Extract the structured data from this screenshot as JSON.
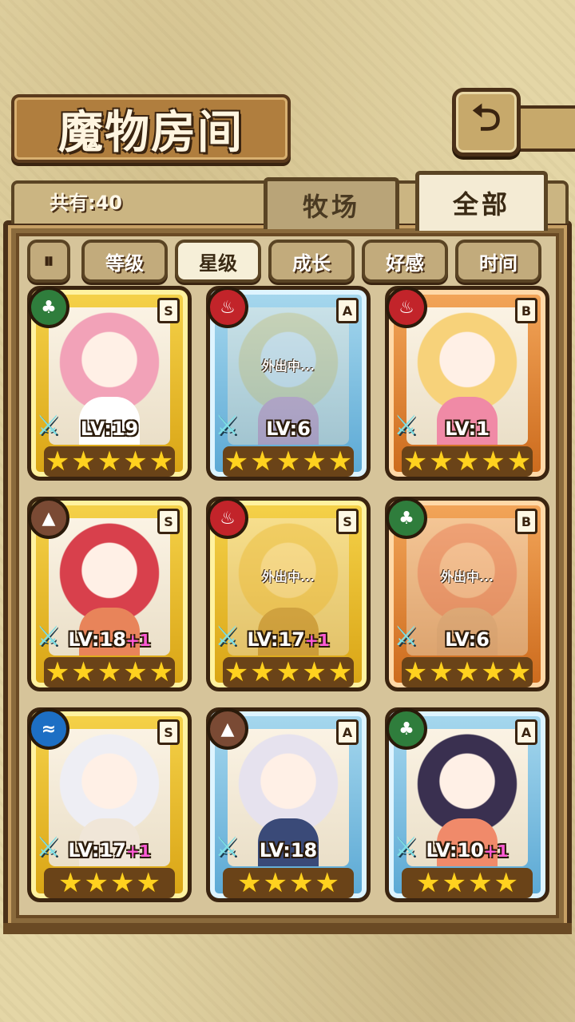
{
  "title": "魔物房间",
  "back_icon": "back-arrow-icon",
  "count_text": "共有:40",
  "top_tabs": [
    {
      "label": "牧场",
      "active": false
    },
    {
      "label": "全部",
      "active": true
    }
  ],
  "sort_buttons": [
    {
      "label": "等级",
      "active": false
    },
    {
      "label": "星级",
      "active": true
    },
    {
      "label": "成长",
      "active": false
    },
    {
      "label": "好感",
      "active": false
    },
    {
      "label": "时间",
      "active": false
    }
  ],
  "away_label": "外出中...",
  "monsters": [
    {
      "element": "grass",
      "grade": "S",
      "frame": "gold",
      "level": "LV:19",
      "plus": "",
      "stars": 5,
      "away": false,
      "hair": "#f2a2b8",
      "outfit": "#ffffff"
    },
    {
      "element": "fire",
      "grade": "A",
      "frame": "blue",
      "level": "LV:6",
      "plus": "",
      "stars": 5,
      "away": true,
      "hair": "#f7d27a",
      "outfit": "#f08aa6"
    },
    {
      "element": "fire",
      "grade": "B",
      "frame": "bronze",
      "level": "LV:1",
      "plus": "",
      "stars": 5,
      "away": false,
      "hair": "#f7d27a",
      "outfit": "#f08aa6"
    },
    {
      "element": "rock",
      "grade": "S",
      "frame": "gold",
      "level": "LV:18",
      "plus": "+1",
      "stars": 5,
      "away": false,
      "hair": "#d8404c",
      "outfit": "#e8845a"
    },
    {
      "element": "fire",
      "grade": "S",
      "frame": "gold",
      "level": "LV:17",
      "plus": "+1",
      "stars": 5,
      "away": true,
      "hair": "#f1d08a",
      "outfit": "#b88a5a"
    },
    {
      "element": "grass",
      "grade": "B",
      "frame": "bronze",
      "level": "LV:6",
      "plus": "",
      "stars": 5,
      "away": true,
      "hair": "#f0a6a0",
      "outfit": "#dcd6c4"
    },
    {
      "element": "water",
      "grade": "S",
      "frame": "gold",
      "level": "LV:17",
      "plus": "+1",
      "stars": 4,
      "away": false,
      "hair": "#eeeef4",
      "outfit": "#f0e6d8"
    },
    {
      "element": "rock",
      "grade": "A",
      "frame": "blue",
      "level": "LV:18",
      "plus": "",
      "stars": 4,
      "away": false,
      "hair": "#e6e2ee",
      "outfit": "#3a4a78"
    },
    {
      "element": "grass",
      "grade": "A",
      "frame": "blue",
      "level": "LV:10",
      "plus": "+1",
      "stars": 4,
      "away": false,
      "hair": "#3a3050",
      "outfit": "#f08a6a"
    }
  ]
}
